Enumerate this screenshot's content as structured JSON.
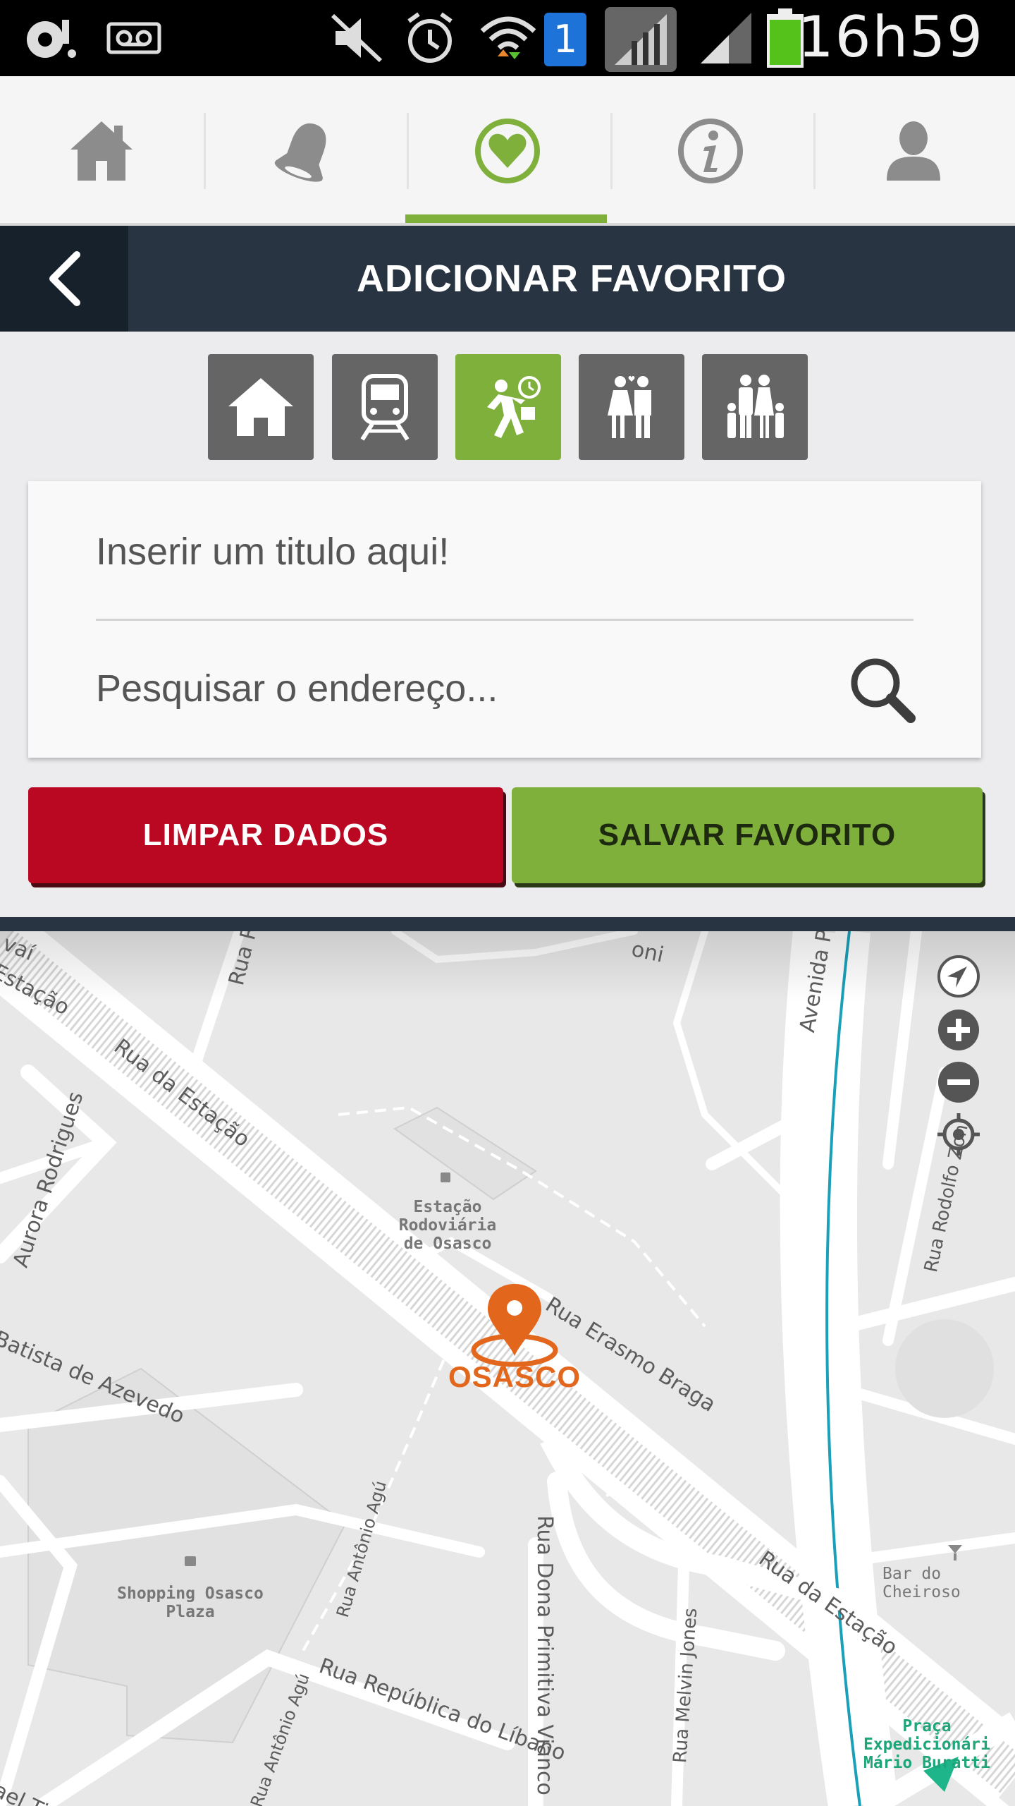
{
  "status_bar": {
    "time": "16h59",
    "sim_badge": "1",
    "icons": [
      "voicemail-app-icon",
      "voicemail-icon",
      "mute-icon",
      "alarm-icon",
      "wifi-icon",
      "sim-icon",
      "signal-icon",
      "signal-icon-2",
      "battery-icon"
    ]
  },
  "nav": {
    "items": [
      {
        "name": "home",
        "icon": "home-icon",
        "active": false
      },
      {
        "name": "notifications",
        "icon": "bell-icon",
        "active": false
      },
      {
        "name": "favorites",
        "icon": "heart-icon",
        "active": true
      },
      {
        "name": "info",
        "icon": "info-icon",
        "active": false
      },
      {
        "name": "profile",
        "icon": "user-icon",
        "active": false
      }
    ],
    "accent": "#7fb03b"
  },
  "header": {
    "title": "ADICIONAR FAVORITO",
    "back_icon": "chevron-left-icon"
  },
  "categories": [
    {
      "name": "home",
      "icon": "home-icon",
      "active": false
    },
    {
      "name": "train",
      "icon": "train-icon",
      "active": false
    },
    {
      "name": "work",
      "icon": "commuter-icon",
      "active": true
    },
    {
      "name": "couple",
      "icon": "couple-icon",
      "active": false
    },
    {
      "name": "family",
      "icon": "family-icon",
      "active": false
    }
  ],
  "form": {
    "title_placeholder": "Inserir um titulo aqui!",
    "address_placeholder": "Pesquisar o endereço...",
    "clear_label": "LIMPAR DADOS",
    "save_label": "SALVAR FAVORITO"
  },
  "colors": {
    "clear": "#bb0822",
    "save": "#7fb03b",
    "header": "#283442",
    "marker": "#e2671c"
  },
  "map": {
    "marker_label": "OSASCO",
    "streets": [
      "Rua da Estação",
      "Estação",
      "Rua da Estação",
      "Aurora Rodrigues",
      "Batista de Azevedo",
      "Rua Erasmo Braga",
      "Rua Dona Primitiva Vianco",
      "Rua Antônio Agú",
      "Rua Antônio Agú",
      "Rua República do Líbano",
      "Rua Melvin Jones",
      "Rua da Estação",
      "Avenida P",
      "Rua Rodolfo Zoni",
      "Rua Ro",
      "vaí",
      "oni",
      "ael Tito"
    ],
    "pois": [
      {
        "name": "Estação Rodoviária de Osasco",
        "line1": "Estação Rodoviária",
        "line2": "de Osasco"
      },
      {
        "name": "Shopping Osasco Plaza",
        "line1": "Shopping Osasco",
        "line2": "Plaza"
      },
      {
        "name": "Bar do Cheiroso",
        "line1": "Bar do Cheiroso"
      },
      {
        "name": "Praça Expedicionário Mário Buratti",
        "line1": "Praça Expedicionári",
        "line2": "Mário Buratti"
      }
    ],
    "controls": [
      "locate-icon",
      "zoom-in-icon",
      "zoom-out-icon",
      "gps-target-icon"
    ]
  }
}
